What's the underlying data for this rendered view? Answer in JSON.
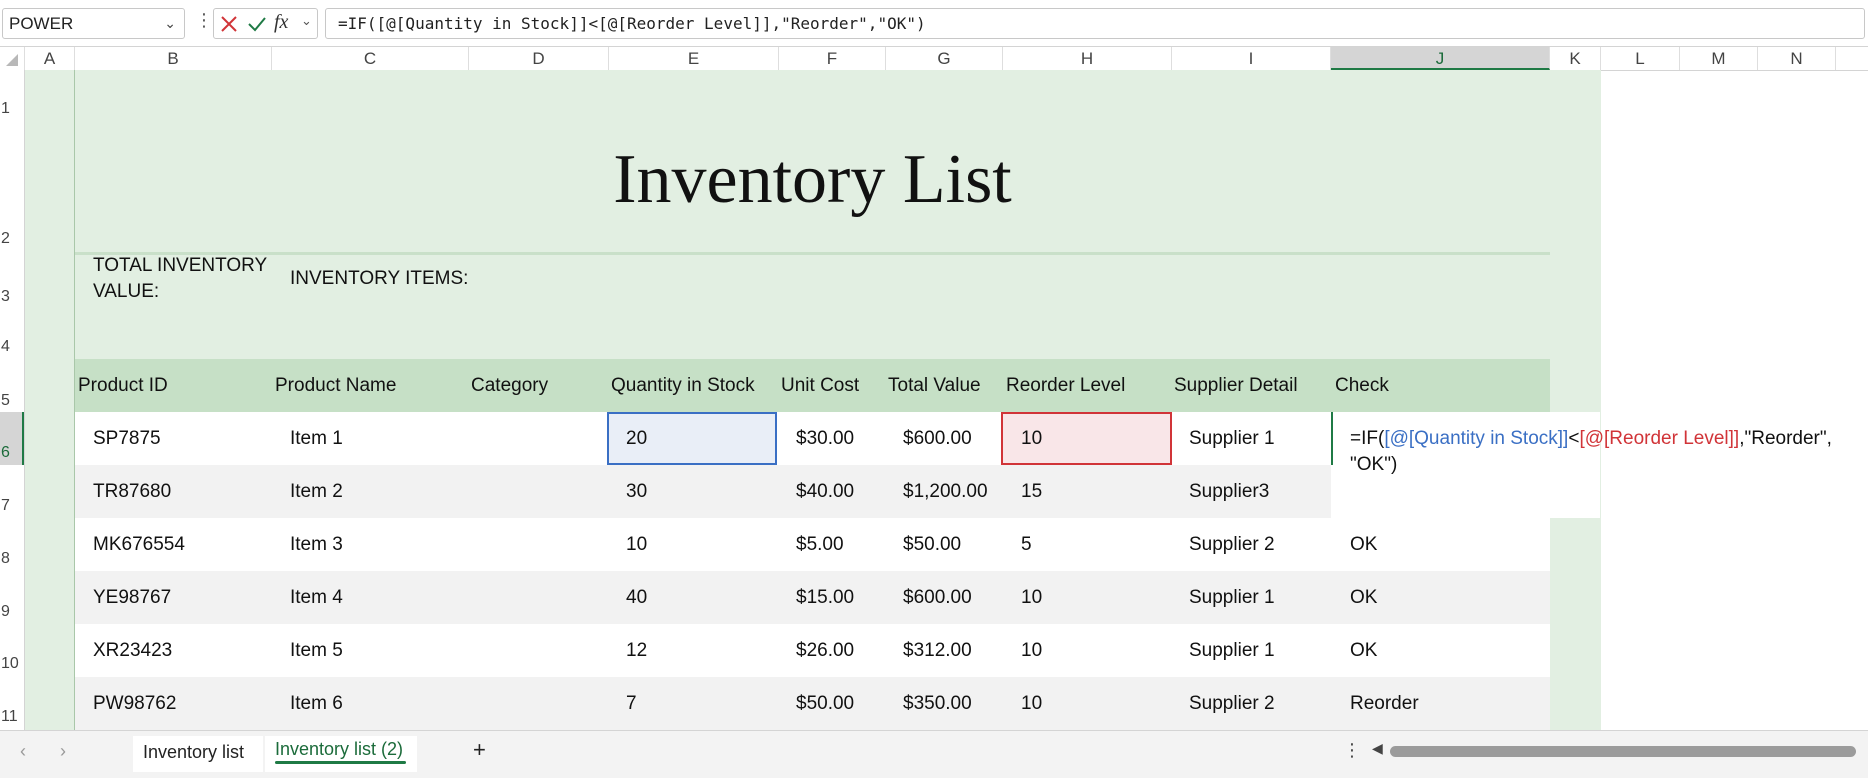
{
  "formula_bar": {
    "name_box": "POWER",
    "formula": "=IF([@[Quantity in Stock]]<[@[Reorder Level]],\"Reorder\",\"OK\")"
  },
  "columns": [
    "A",
    "B",
    "C",
    "D",
    "E",
    "F",
    "G",
    "H",
    "I",
    "J",
    "K",
    "L",
    "M",
    "N"
  ],
  "rows": [
    "1",
    "2",
    "3",
    "4",
    "5",
    "6",
    "7",
    "8",
    "9",
    "10",
    "11"
  ],
  "sheet": {
    "title": "Inventory List",
    "total_inventory_label_1": "TOTAL INVENTORY",
    "total_inventory_label_2": "VALUE:",
    "inventory_items_label": "INVENTORY ITEMS:",
    "headers": [
      "Product ID",
      "Product Name",
      "Category",
      "Quantity in Stock",
      "Unit Cost",
      "Total Value",
      "Reorder Level",
      "Supplier Detail",
      "Check"
    ],
    "data": [
      [
        "SP7875",
        "Item 1",
        "",
        "20",
        "$30.00",
        "$600.00",
        "10",
        "Supplier 1",
        ""
      ],
      [
        "TR87680",
        "Item 2",
        "",
        "30",
        "$40.00",
        "$1,200.00",
        "15",
        "Supplier3",
        ""
      ],
      [
        "MK676554",
        "Item 3",
        "",
        "10",
        "$5.00",
        "$50.00",
        "5",
        "Supplier 2",
        "OK"
      ],
      [
        "YE98767",
        "Item 4",
        "",
        "40",
        "$15.00",
        "$600.00",
        "10",
        "Supplier 1",
        "OK"
      ],
      [
        "XR23423",
        "Item 5",
        "",
        "12",
        "$26.00",
        "$312.00",
        "10",
        "Supplier 1",
        "OK"
      ],
      [
        "PW98762",
        "Item 6",
        "",
        "7",
        "$50.00",
        "$350.00",
        "10",
        "Supplier 2",
        "Reorder"
      ]
    ],
    "edit_formula": {
      "prefix": "=IF(",
      "ref1": "[@[Quantity in Stock]]",
      "op": "<",
      "ref2": "[@[Reorder Level]]",
      "suffix1": ",\"Reorder\",",
      "suffix2": "\"OK\")"
    }
  },
  "tabs": {
    "sheet1": "Inventory list",
    "sheet2": "Inventory list (2)",
    "add": "+"
  },
  "colors": {
    "green_band": "#e2efe2",
    "header_green": "#c6e0c6",
    "ref_blue": "#3a6fc4",
    "ref_red": "#d13438",
    "accent": "#1f7a45"
  }
}
